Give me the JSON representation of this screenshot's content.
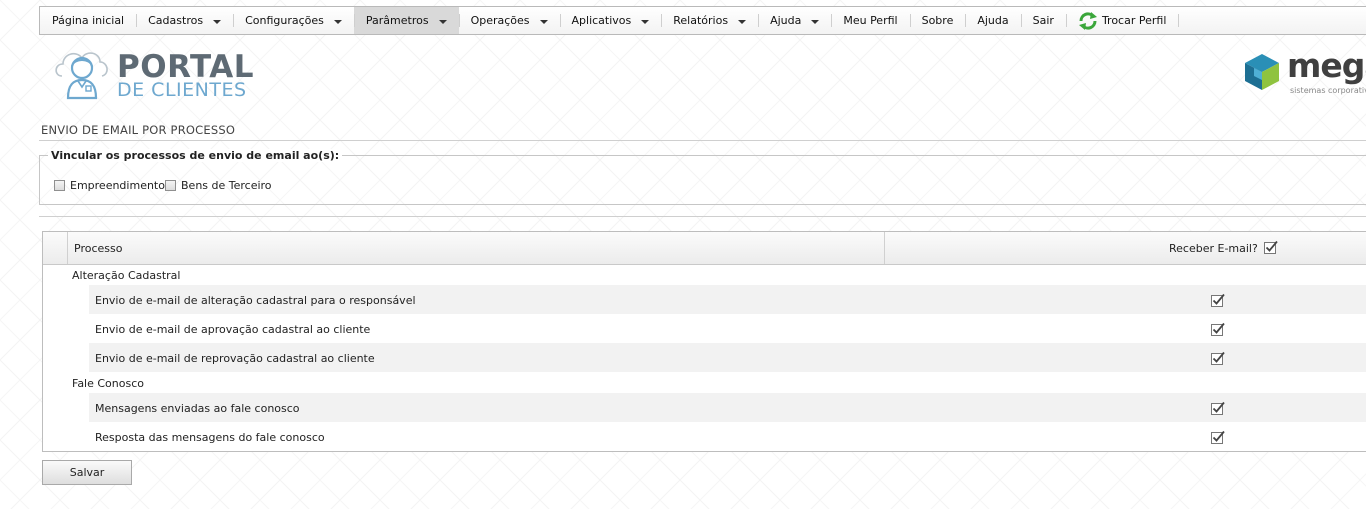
{
  "menu": [
    {
      "label": "Página inicial",
      "dropdown": false
    },
    {
      "label": "Cadastros",
      "dropdown": true
    },
    {
      "label": "Configurações",
      "dropdown": true
    },
    {
      "label": "Parâmetros",
      "dropdown": true,
      "active": true
    },
    {
      "label": "Operações",
      "dropdown": true
    },
    {
      "label": "Aplicativos",
      "dropdown": true
    },
    {
      "label": "Relatórios",
      "dropdown": true
    },
    {
      "label": "Ajuda",
      "dropdown": true
    },
    {
      "label": "Meu Perfil",
      "dropdown": false
    },
    {
      "label": "Sobre",
      "dropdown": false
    },
    {
      "label": "Ajuda",
      "dropdown": false
    },
    {
      "label": "Sair",
      "dropdown": false
    },
    {
      "label": "Trocar Perfil",
      "dropdown": false,
      "icon": "refresh-icon"
    }
  ],
  "branding": {
    "portal_line1": "PORTAL",
    "portal_line2": "DE CLIENTES",
    "mega_name": "mega",
    "mega_tagline": "sistemas corporativos"
  },
  "page": {
    "title": "ENVIO DE EMAIL POR PROCESSO",
    "fieldset_legend": "Vincular os processos de envio de email ao(s):",
    "options": [
      {
        "label": "Empreendimento",
        "checked": false
      },
      {
        "label": "Bens de Terceiro",
        "checked": false
      }
    ]
  },
  "grid": {
    "col_process": "Processo",
    "col_receive": "Receber E-mail?",
    "header_checked": true,
    "groups": [
      {
        "name": "Alteração Cadastral",
        "rows": [
          {
            "label": "Envio de e-mail de alteração cadastral para o responsável",
            "checked": true
          },
          {
            "label": "Envio de e-mail de aprovação cadastral ao cliente",
            "checked": true
          },
          {
            "label": "Envio de e-mail de reprovação cadastral ao cliente",
            "checked": true
          }
        ]
      },
      {
        "name": "Fale Conosco",
        "rows": [
          {
            "label": "Mensagens enviadas ao fale conosco",
            "checked": true
          },
          {
            "label": "Resposta das mensagens do fale conosco",
            "checked": true
          }
        ]
      }
    ]
  },
  "actions": {
    "save_label": "Salvar"
  },
  "colors": {
    "portal_dark": "#5e6a74",
    "portal_light": "#6ea8cf",
    "active_menu": "#d9d9d9",
    "alt_row": "#f2f2f2",
    "refresh_green": "#3aa63a"
  }
}
